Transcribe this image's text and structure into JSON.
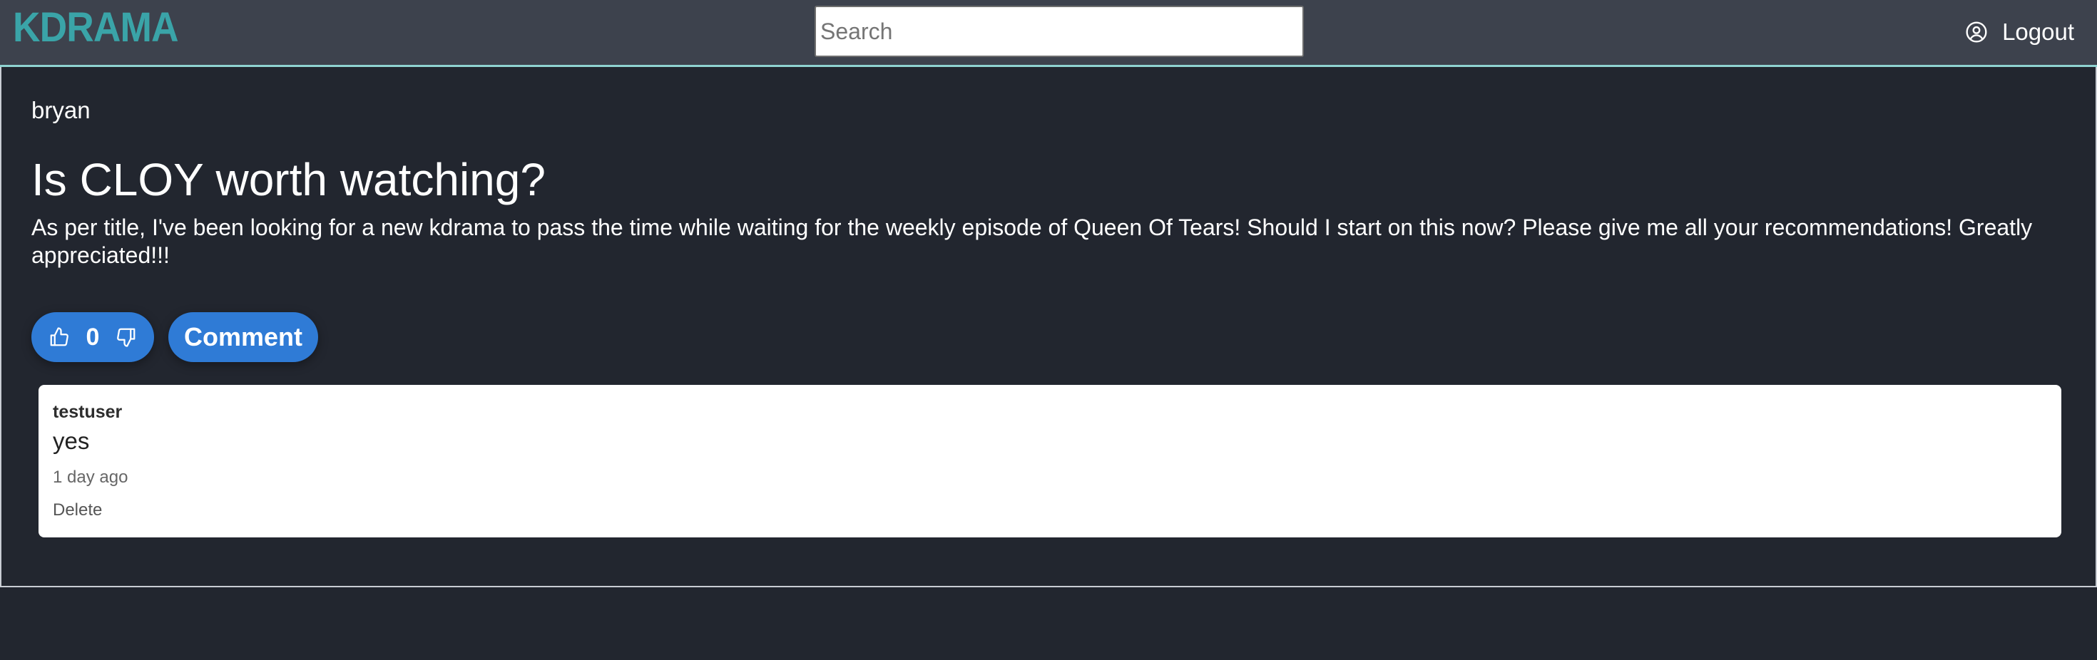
{
  "header": {
    "logo": "KDRAMA",
    "search_placeholder": "Search",
    "search_value": "",
    "logout_label": "Logout"
  },
  "post": {
    "author": "bryan",
    "title": "Is CLOY worth watching?",
    "body": "As per title, I've been looking for a new kdrama to pass the time while waiting for the weekly episode of Queen Of Tears! Should I start on this now? Please give me all your recommendations! Greatly appreciated!!!",
    "vote_count": "0",
    "comment_button_label": "Comment"
  },
  "comments": [
    {
      "author": "testuser",
      "text": "yes",
      "time": "1 day ago",
      "delete_label": "Delete"
    }
  ],
  "colors": {
    "page_bg": "#22262f",
    "navbar_bg": "#3d424d",
    "logo": "#3aa4a8",
    "accent": "#2f7bd6",
    "navbar_border": "#8fd3d1"
  },
  "icons": {
    "logout": "user-circle-icon",
    "upvote": "thumbs-up-icon",
    "downvote": "thumbs-down-icon"
  }
}
